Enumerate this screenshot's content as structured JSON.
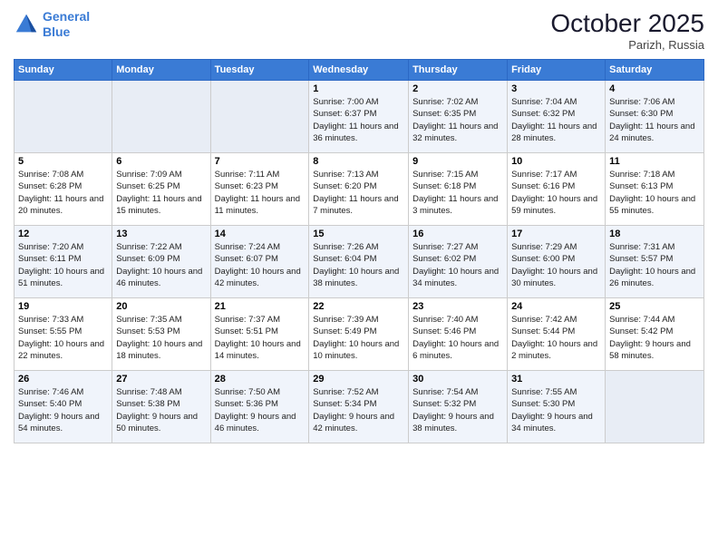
{
  "header": {
    "logo_line1": "General",
    "logo_line2": "Blue",
    "month": "October 2025",
    "location": "Parizh, Russia"
  },
  "weekdays": [
    "Sunday",
    "Monday",
    "Tuesday",
    "Wednesday",
    "Thursday",
    "Friday",
    "Saturday"
  ],
  "rows": [
    [
      {
        "day": "",
        "info": ""
      },
      {
        "day": "",
        "info": ""
      },
      {
        "day": "",
        "info": ""
      },
      {
        "day": "1",
        "info": "Sunrise: 7:00 AM\nSunset: 6:37 PM\nDaylight: 11 hours\nand 36 minutes."
      },
      {
        "day": "2",
        "info": "Sunrise: 7:02 AM\nSunset: 6:35 PM\nDaylight: 11 hours\nand 32 minutes."
      },
      {
        "day": "3",
        "info": "Sunrise: 7:04 AM\nSunset: 6:32 PM\nDaylight: 11 hours\nand 28 minutes."
      },
      {
        "day": "4",
        "info": "Sunrise: 7:06 AM\nSunset: 6:30 PM\nDaylight: 11 hours\nand 24 minutes."
      }
    ],
    [
      {
        "day": "5",
        "info": "Sunrise: 7:08 AM\nSunset: 6:28 PM\nDaylight: 11 hours\nand 20 minutes."
      },
      {
        "day": "6",
        "info": "Sunrise: 7:09 AM\nSunset: 6:25 PM\nDaylight: 11 hours\nand 15 minutes."
      },
      {
        "day": "7",
        "info": "Sunrise: 7:11 AM\nSunset: 6:23 PM\nDaylight: 11 hours\nand 11 minutes."
      },
      {
        "day": "8",
        "info": "Sunrise: 7:13 AM\nSunset: 6:20 PM\nDaylight: 11 hours\nand 7 minutes."
      },
      {
        "day": "9",
        "info": "Sunrise: 7:15 AM\nSunset: 6:18 PM\nDaylight: 11 hours\nand 3 minutes."
      },
      {
        "day": "10",
        "info": "Sunrise: 7:17 AM\nSunset: 6:16 PM\nDaylight: 10 hours\nand 59 minutes."
      },
      {
        "day": "11",
        "info": "Sunrise: 7:18 AM\nSunset: 6:13 PM\nDaylight: 10 hours\nand 55 minutes."
      }
    ],
    [
      {
        "day": "12",
        "info": "Sunrise: 7:20 AM\nSunset: 6:11 PM\nDaylight: 10 hours\nand 51 minutes."
      },
      {
        "day": "13",
        "info": "Sunrise: 7:22 AM\nSunset: 6:09 PM\nDaylight: 10 hours\nand 46 minutes."
      },
      {
        "day": "14",
        "info": "Sunrise: 7:24 AM\nSunset: 6:07 PM\nDaylight: 10 hours\nand 42 minutes."
      },
      {
        "day": "15",
        "info": "Sunrise: 7:26 AM\nSunset: 6:04 PM\nDaylight: 10 hours\nand 38 minutes."
      },
      {
        "day": "16",
        "info": "Sunrise: 7:27 AM\nSunset: 6:02 PM\nDaylight: 10 hours\nand 34 minutes."
      },
      {
        "day": "17",
        "info": "Sunrise: 7:29 AM\nSunset: 6:00 PM\nDaylight: 10 hours\nand 30 minutes."
      },
      {
        "day": "18",
        "info": "Sunrise: 7:31 AM\nSunset: 5:57 PM\nDaylight: 10 hours\nand 26 minutes."
      }
    ],
    [
      {
        "day": "19",
        "info": "Sunrise: 7:33 AM\nSunset: 5:55 PM\nDaylight: 10 hours\nand 22 minutes."
      },
      {
        "day": "20",
        "info": "Sunrise: 7:35 AM\nSunset: 5:53 PM\nDaylight: 10 hours\nand 18 minutes."
      },
      {
        "day": "21",
        "info": "Sunrise: 7:37 AM\nSunset: 5:51 PM\nDaylight: 10 hours\nand 14 minutes."
      },
      {
        "day": "22",
        "info": "Sunrise: 7:39 AM\nSunset: 5:49 PM\nDaylight: 10 hours\nand 10 minutes."
      },
      {
        "day": "23",
        "info": "Sunrise: 7:40 AM\nSunset: 5:46 PM\nDaylight: 10 hours\nand 6 minutes."
      },
      {
        "day": "24",
        "info": "Sunrise: 7:42 AM\nSunset: 5:44 PM\nDaylight: 10 hours\nand 2 minutes."
      },
      {
        "day": "25",
        "info": "Sunrise: 7:44 AM\nSunset: 5:42 PM\nDaylight: 9 hours\nand 58 minutes."
      }
    ],
    [
      {
        "day": "26",
        "info": "Sunrise: 7:46 AM\nSunset: 5:40 PM\nDaylight: 9 hours\nand 54 minutes."
      },
      {
        "day": "27",
        "info": "Sunrise: 7:48 AM\nSunset: 5:38 PM\nDaylight: 9 hours\nand 50 minutes."
      },
      {
        "day": "28",
        "info": "Sunrise: 7:50 AM\nSunset: 5:36 PM\nDaylight: 9 hours\nand 46 minutes."
      },
      {
        "day": "29",
        "info": "Sunrise: 7:52 AM\nSunset: 5:34 PM\nDaylight: 9 hours\nand 42 minutes."
      },
      {
        "day": "30",
        "info": "Sunrise: 7:54 AM\nSunset: 5:32 PM\nDaylight: 9 hours\nand 38 minutes."
      },
      {
        "day": "31",
        "info": "Sunrise: 7:55 AM\nSunset: 5:30 PM\nDaylight: 9 hours\nand 34 minutes."
      },
      {
        "day": "",
        "info": ""
      }
    ]
  ]
}
